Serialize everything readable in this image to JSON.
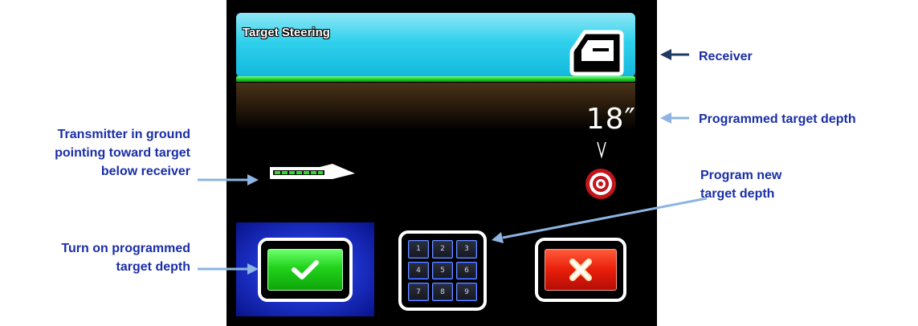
{
  "screen": {
    "title": "Target Steering",
    "target_depth": "18″",
    "icons": {
      "receiver": "receiver-icon",
      "transmitter": "transmitter-icon",
      "down_arrow": "down-arrow-icon",
      "target": "target-icon",
      "check": "checkmark-icon",
      "keypad": "keypad-icon",
      "cancel": "x-icon"
    },
    "keypad_keys": [
      "1",
      "2",
      "3",
      "4",
      "5",
      "6",
      "7",
      "8",
      "9"
    ]
  },
  "annotations": {
    "receiver": "Receiver",
    "programmed_target_depth": "Programmed target depth",
    "transmitter_lines": [
      "Transmitter in ground",
      "pointing toward target",
      "below receiver"
    ],
    "program_new_lines": [
      "Program new",
      "target depth"
    ],
    "turn_on_lines": [
      "Turn on programmed",
      "target depth"
    ]
  },
  "colors": {
    "annotation_text": "#1a2ea8",
    "annotation_arrow": "#8db4e2",
    "receiver_arrow": "#1f3864",
    "header_cyan": "#2fd0ec",
    "ground_green": "#17c41c",
    "check_green": "#21d21b",
    "cancel_red": "#e81e0a",
    "selection_blue": "#1b2fc4"
  }
}
